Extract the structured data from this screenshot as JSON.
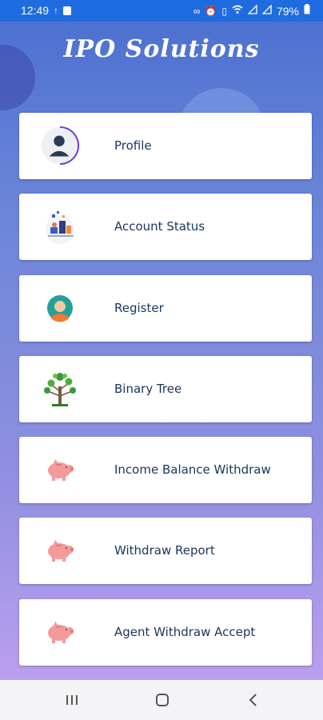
{
  "status_bar": {
    "time": "12:49",
    "battery": "79%",
    "left_icons": [
      "usb-icon",
      "message-icon"
    ],
    "right_icons": [
      "link-icon",
      "alarm-icon",
      "vibrate-icon",
      "wifi-icon",
      "signal-icon",
      "signal-icon"
    ]
  },
  "app": {
    "title": "IPO Solutions"
  },
  "menu": {
    "items": [
      {
        "label": "Profile",
        "icon": "profile-icon"
      },
      {
        "label": "Account Status",
        "icon": "account-status-icon"
      },
      {
        "label": "Register",
        "icon": "register-person-icon"
      },
      {
        "label": "Binary Tree",
        "icon": "tree-icon"
      },
      {
        "label": "Income Balance Withdraw",
        "icon": "piggy-bank-icon"
      },
      {
        "label": "Withdraw Report",
        "icon": "piggy-bank-icon"
      },
      {
        "label": "Agent Withdraw Accept",
        "icon": "piggy-bank-icon"
      }
    ]
  },
  "colors": {
    "status_bar": "#1f6ce0",
    "label_text": "#18365e",
    "piggy": "#f49a9a",
    "background_top": "#4a6fd0",
    "background_bottom": "#c3a2f2"
  }
}
